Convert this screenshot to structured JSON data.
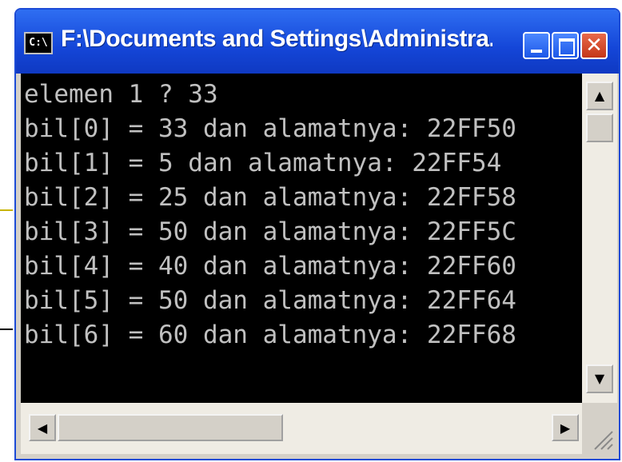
{
  "window": {
    "title": "F:\\Documents and Settings\\Administra...",
    "icon_label": "C:\\",
    "controls": {
      "minimize": "minimize-icon",
      "maximize": "maximize-icon",
      "close": "close-icon"
    }
  },
  "console_lines": [
    "elemen 1 ? 33",
    "bil[0] = 33 dan alamatnya: 22FF50",
    "bil[1] = 5 dan alamatnya: 22FF54",
    "bil[2] = 25 dan alamatnya: 22FF58",
    "bil[3] = 50 dan alamatnya: 22FF5C",
    "bil[4] = 40 dan alamatnya: 22FF60",
    "bil[5] = 50 dan alamatnya: 22FF64",
    "bil[6] = 60 dan alamatnya: 22FF68"
  ],
  "scrollbars": {
    "up": "▲",
    "down": "▼",
    "left": "◀",
    "right": "▶"
  },
  "colors": {
    "titlebar": "#1446d8",
    "console_bg": "#000000",
    "console_text": "#c0c0c0",
    "close_button": "#c43618"
  }
}
